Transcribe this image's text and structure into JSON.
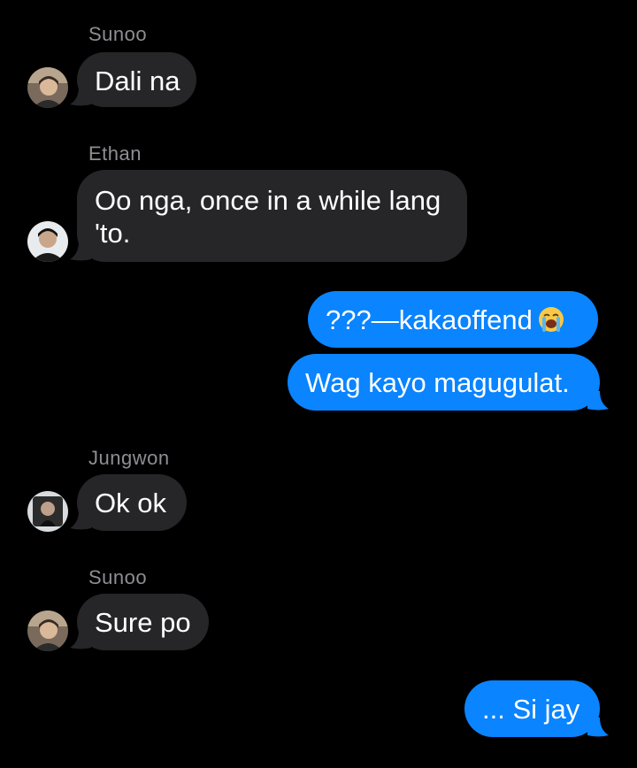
{
  "colors": {
    "background": "#000000",
    "incoming_bubble": "#262629",
    "outgoing_bubble": "#0a84ff",
    "sender_name": "#8e8e93",
    "text": "#ffffff"
  },
  "messages": [
    {
      "sender": "Sunoo",
      "text": "Dali na",
      "direction": "incoming",
      "avatar": "sunoo-avatar"
    },
    {
      "sender": "Ethan",
      "text": "Oo nga, once in a while lang 'to.",
      "direction": "incoming",
      "avatar": "ethan-avatar"
    },
    {
      "text": "???—kakaoffend",
      "emoji": "loudly-crying-face",
      "direction": "outgoing"
    },
    {
      "text": "Wag kayo magugulat.",
      "direction": "outgoing"
    },
    {
      "sender": "Jungwon",
      "text": "Ok ok",
      "direction": "incoming",
      "avatar": "jungwon-avatar"
    },
    {
      "sender": "Sunoo",
      "text": "Sure po",
      "direction": "incoming",
      "avatar": "sunoo-avatar"
    },
    {
      "text": "... Si jay",
      "direction": "outgoing"
    }
  ]
}
